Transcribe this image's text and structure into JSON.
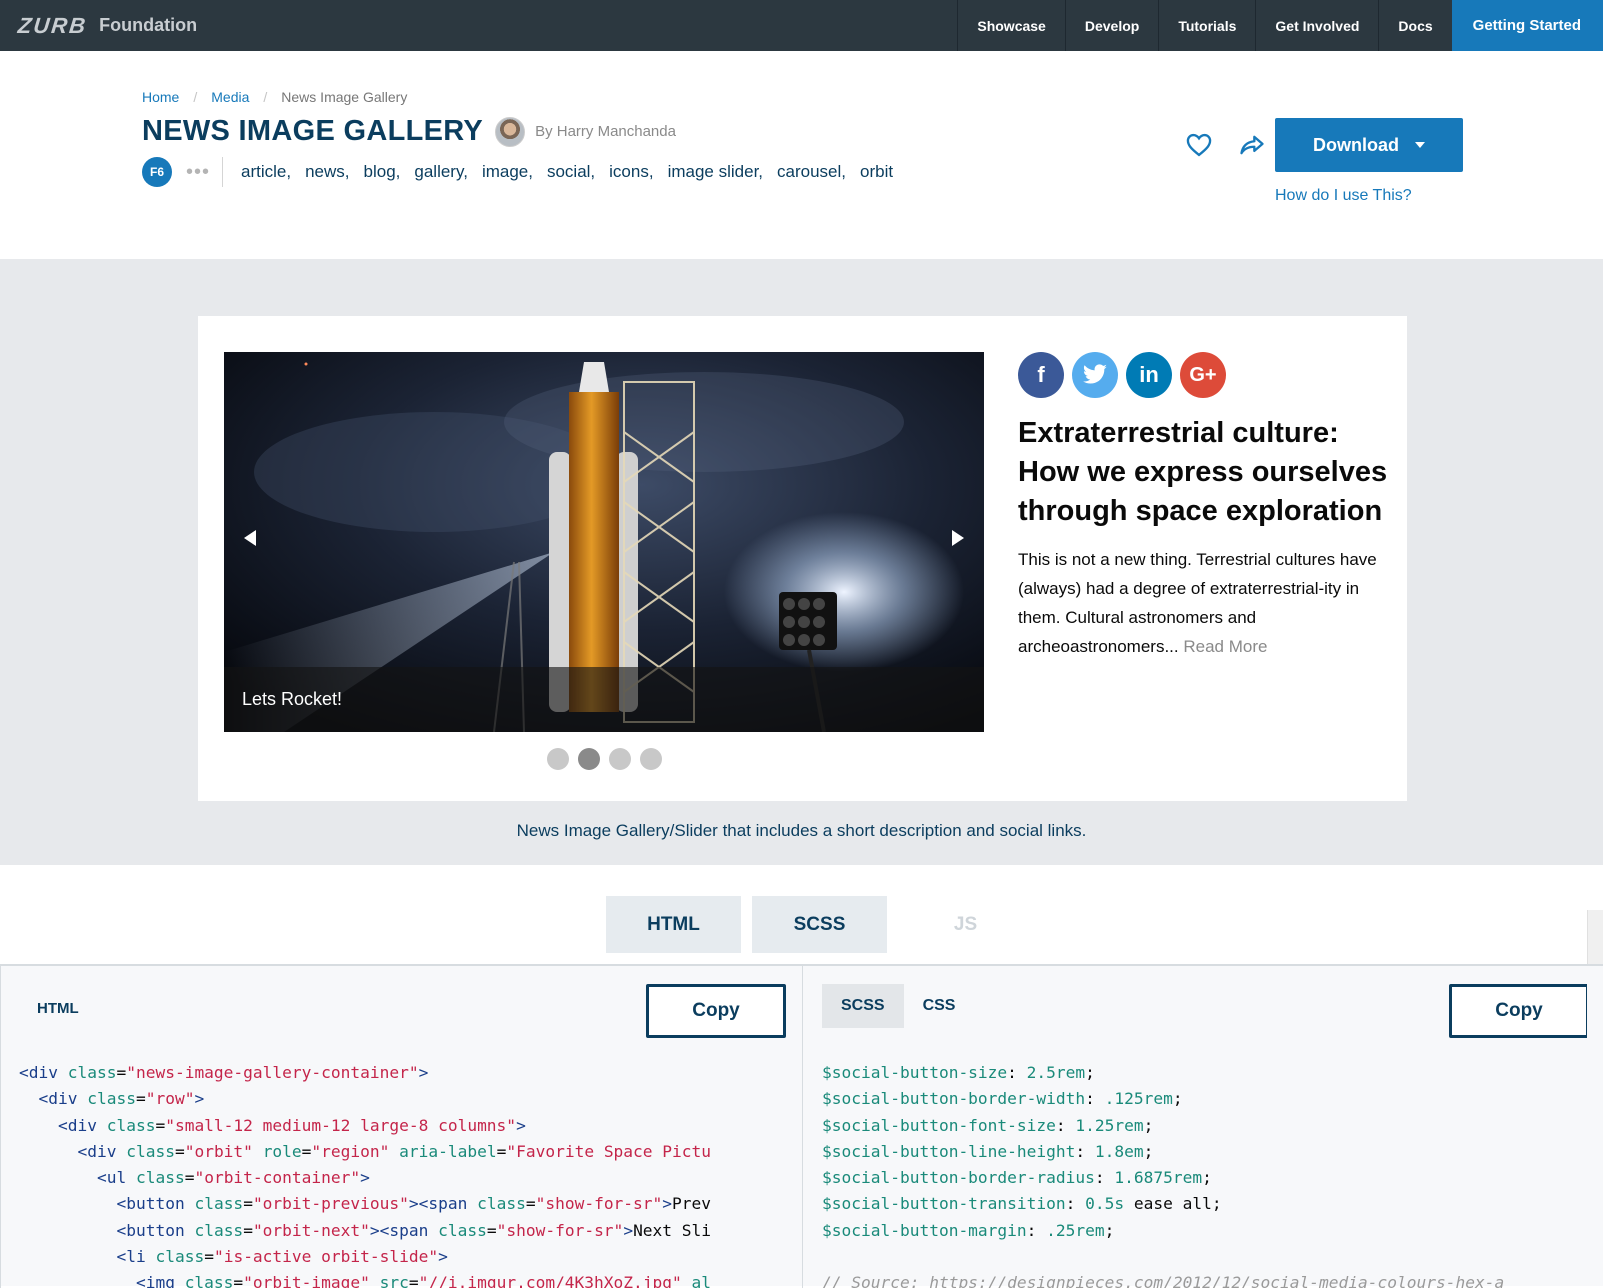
{
  "topbar": {
    "logo": "ZURB",
    "product": "Foundation",
    "nav": [
      "Showcase",
      "Develop",
      "Tutorials",
      "Get Involved",
      "Docs"
    ],
    "cta": "Getting Started"
  },
  "breadcrumb": [
    "Home",
    "Media",
    "News Image Gallery"
  ],
  "header": {
    "title": "NEWS IMAGE GALLERY",
    "author": "By Harry Manchanda",
    "badge": "F6",
    "more": "•••",
    "tags": [
      "article,",
      "news,",
      "blog,",
      "gallery,",
      "image,",
      "social,",
      "icons,",
      "image slider,",
      "carousel,",
      "orbit"
    ],
    "download": "Download",
    "help": "How do I use This?"
  },
  "showcase": {
    "slide_caption": "Lets Rocket!",
    "bullets": [
      false,
      true,
      false,
      false
    ],
    "social": [
      "f",
      "t",
      "in",
      "G+"
    ],
    "article_title": "Extraterrestrial culture: How we express ourselves through space exploration",
    "article_text": "This is not a new thing. Terrestrial cultures have (always) had a degree of extraterrestrial-ity in them. Cultural astronomers and archeoastronomers...",
    "read_more": "Read More",
    "description": "News Image Gallery/Slider that includes a short description and social links."
  },
  "tabs": [
    "HTML",
    "SCSS",
    "JS"
  ],
  "code": {
    "html_label": "HTML",
    "copy": "Copy",
    "scss_tab": "SCSS",
    "css_tab": "CSS",
    "html_lines": [
      "<div class=\"news-image-gallery-container\">",
      "  <div class=\"row\">",
      "    <div class=\"small-12 medium-12 large-8 columns\">",
      "      <div class=\"orbit\" role=\"region\" aria-label=\"Favorite Space Pictu",
      "        <ul class=\"orbit-container\">",
      "          <button class=\"orbit-previous\"><span class=\"show-for-sr\">Prev",
      "          <button class=\"orbit-next\"><span class=\"show-for-sr\">Next Sli",
      "          <li class=\"is-active orbit-slide\">",
      "            <img class=\"orbit-image\" src=\"//i.imgur.com/4K3hXoZ.jpg\" al"
    ],
    "scss_lines": [
      "$social-button-size: 2.5rem;",
      "$social-button-border-width: .125rem;",
      "$social-button-font-size: 1.25rem;",
      "$social-button-line-height: 1.8em;",
      "$social-button-border-radius: 1.6875rem;",
      "$social-button-transition: 0.5s ease all;",
      "$social-button-margin: .25rem;",
      "",
      "// Source: https://designpieces.com/2012/12/social-media-colours-hex-a"
    ]
  }
}
